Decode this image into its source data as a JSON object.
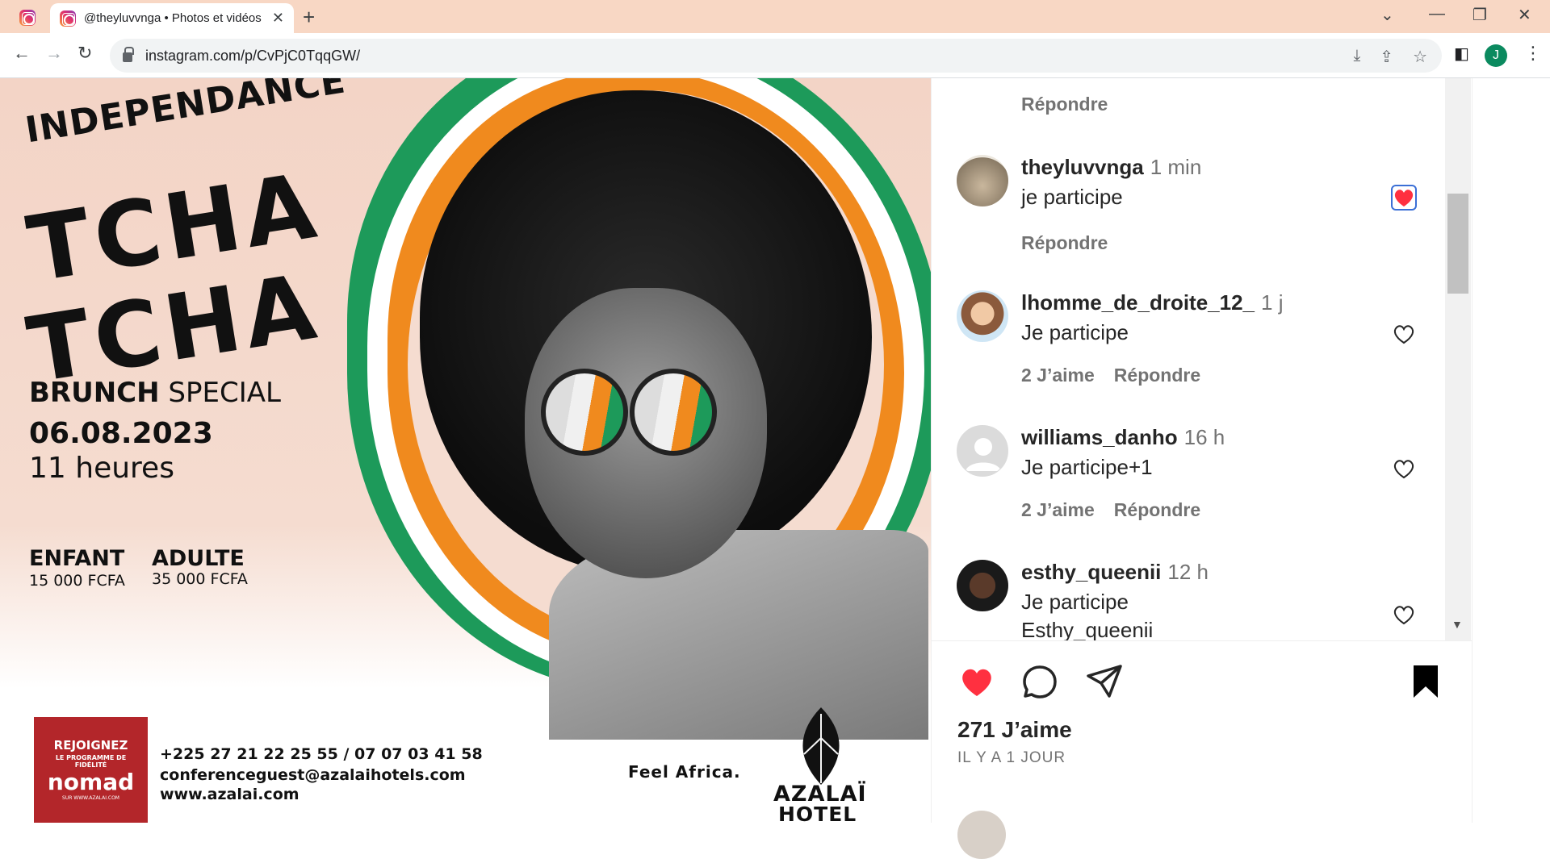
{
  "browser": {
    "tab_title": "@theyluvvnga • Photos et vidéos",
    "url": "instagram.com/p/CvPjC0TqqGW/",
    "profile_initial": "J"
  },
  "poster": {
    "headline_small": "INDEPENDANCE",
    "headline_big_1": "TCHA",
    "headline_big_2": "TCHA",
    "event_bold": "BRUNCH",
    "event_rest": " SPECIAL",
    "date": "06.08.2023",
    "time": "11 heures",
    "price_child_label": "ENFANT",
    "price_child_value": "15 000 FCFA",
    "price_adult_label": "ADULTE",
    "price_adult_value": "35 000 FCFA",
    "loyalty_join": "REJOIGNEZ",
    "loyalty_line": "LE PROGRAMME DE FIDÉLITÉ",
    "loyalty_brand": "nomad",
    "loyalty_site": "SUR WWW.AZALAI.COM",
    "phone": "+225 27 21 22 25 55 / 07 07 03 41 58",
    "email": "conferenceguest@azalaihotels.com",
    "website": "www.azalai.com",
    "slogan": "Feel Africa.",
    "hotel_name": "AZALAÏ",
    "hotel_word": "HOTEL"
  },
  "comments": {
    "top_reply": "Répondre",
    "items": [
      {
        "user": "theyluvvnga",
        "time": "1 min",
        "text": "je participe",
        "text2": "",
        "likes": "",
        "reply": "Répondre",
        "liked": true
      },
      {
        "user": "lhomme_de_droite_12_",
        "time": "1 j",
        "text": "Je participe",
        "text2": "",
        "likes": "2 J’aime",
        "reply": "Répondre",
        "liked": false
      },
      {
        "user": "williams_danho",
        "time": "16 h",
        "text": "Je participe+1",
        "text2": "",
        "likes": "2 J’aime",
        "reply": "Répondre",
        "liked": false
      },
      {
        "user": "esthy_queenii",
        "time": "12 h",
        "text": "Je participe",
        "text2": "Esthy_queenii",
        "likes": "",
        "reply": "",
        "liked": false
      }
    ]
  },
  "actions": {
    "likes": "271 J’aime",
    "date": "IL Y A 1 JOUR"
  },
  "colors": {
    "accent_red": "#ff3040",
    "tab_bar": "#f8d7c4",
    "civ_orange": "#f08a1e",
    "civ_green": "#1d9a5a"
  }
}
